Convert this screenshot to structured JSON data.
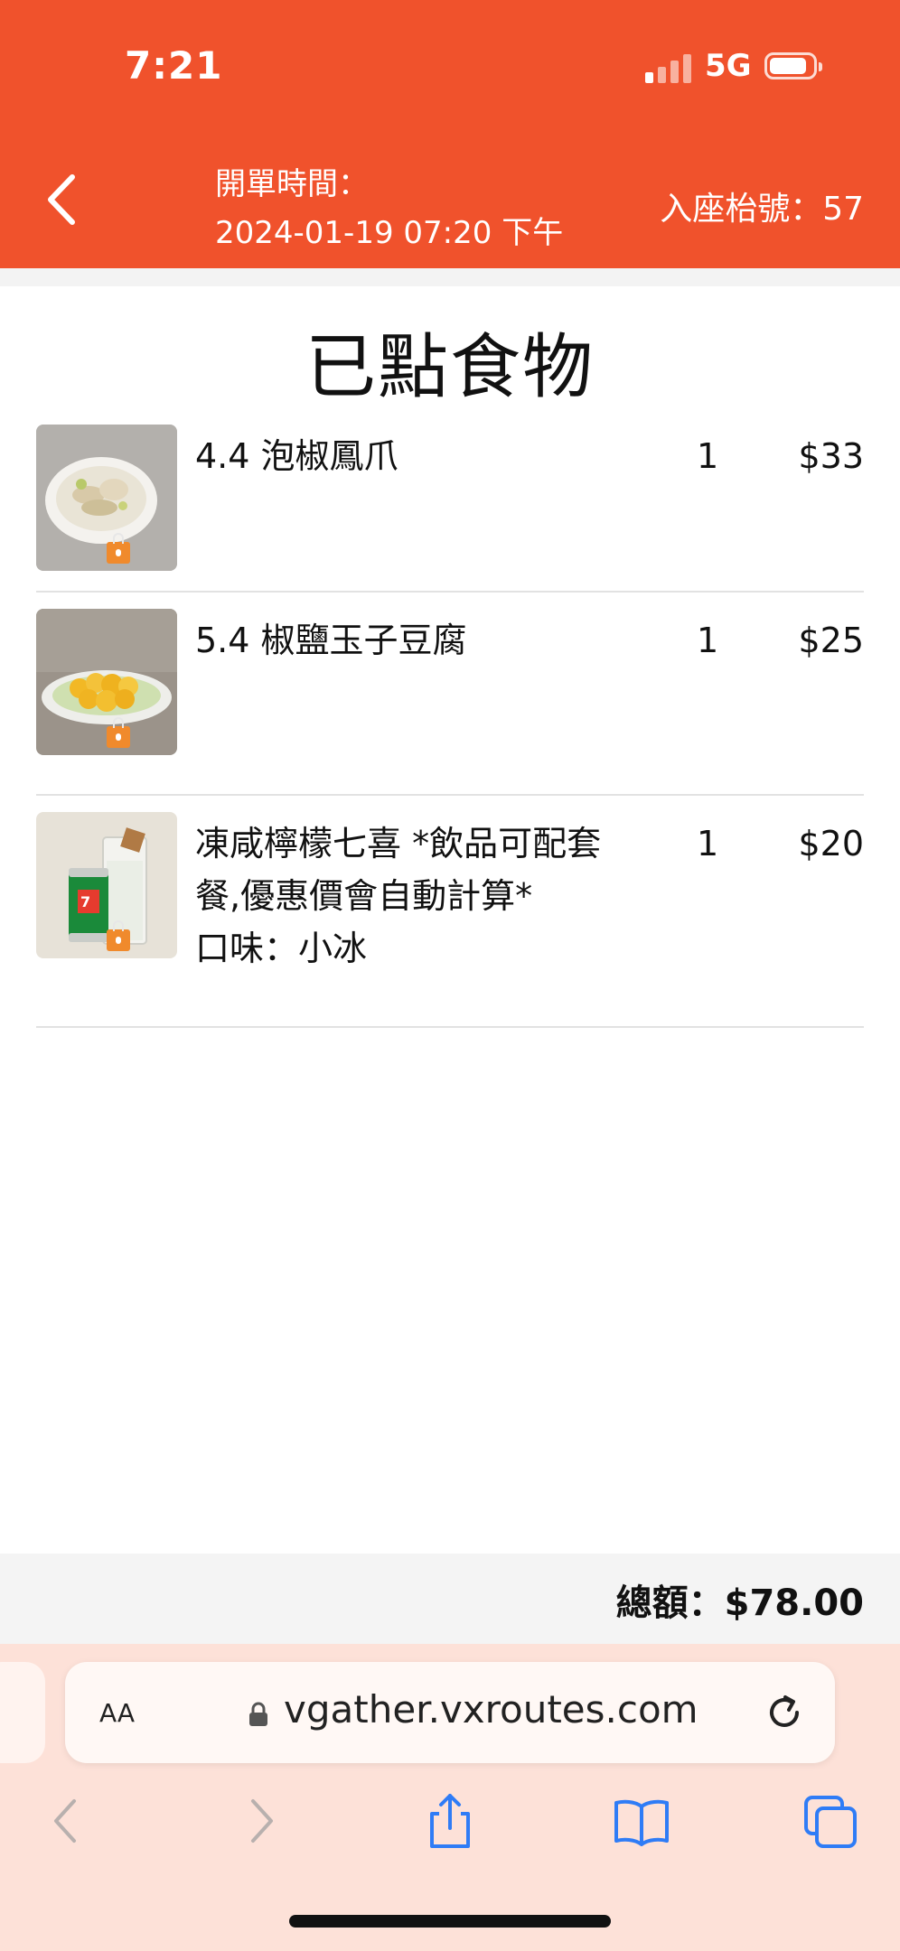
{
  "status_bar": {
    "time": "7:21",
    "network": "5G"
  },
  "header": {
    "open_time_label": "開單時間：",
    "open_time_value": "2024-01-19 07:20 下午",
    "table_number": "入座枱號：57"
  },
  "page_title": "已點食物",
  "order_items": [
    {
      "name": "4.4 泡椒鳳爪",
      "note": "",
      "quantity": "1",
      "price": "$33"
    },
    {
      "name": "5.4 椒鹽玉子豆腐",
      "note": "",
      "quantity": "1",
      "price": "$25"
    },
    {
      "name": "凍咸檸檬七喜 *飲品可配套餐,優惠價會自動計算*",
      "note": "口味：小冰",
      "quantity": "1",
      "price": "$20"
    }
  ],
  "total": "總額：$78.00",
  "browser": {
    "text_size_label": "AA",
    "url": "vgather.vxroutes.com"
  },
  "colors": {
    "header_bg": "#f0522c",
    "browser_bg": "#fde1d8",
    "accent_blue": "#2f7cf6",
    "lock_badge": "#f08a2c"
  },
  "icons": [
    "back-chevron-icon",
    "signal-icon",
    "battery-icon",
    "lock-icon",
    "reload-icon",
    "share-icon",
    "bookmarks-icon",
    "tabs-icon"
  ]
}
